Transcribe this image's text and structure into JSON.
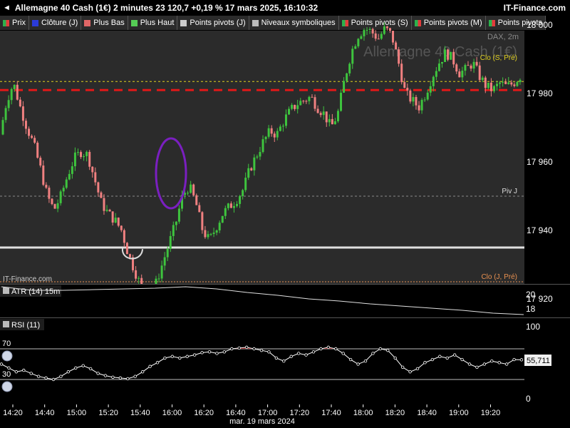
{
  "header": {
    "title": "Allemagne 40 Cash (1€) 2 minutes 23 120,7 +0,19 % 17 mars 2025, 16:10:32",
    "brand": "IT-Finance.com"
  },
  "legend": [
    {
      "label": "Prix",
      "color": "#2bb24c",
      "color2": "#e23b3b"
    },
    {
      "label": "Clôture (J)",
      "color": "#2b3bd8"
    },
    {
      "label": "Plus Bas",
      "color": "#e06666"
    },
    {
      "label": "Plus Haut",
      "color": "#55cc55"
    },
    {
      "label": "Points pivots (J)",
      "color": "#cccccc"
    },
    {
      "label": "Niveaux symboliques",
      "color": "#bbbbbb"
    },
    {
      "label": "Points pivots (S)",
      "color": "#2bb24c",
      "color2": "#e23b3b"
    },
    {
      "label": "Points pivots (M)",
      "color": "#2bb24c",
      "color2": "#e23b3b"
    },
    {
      "label": "Points pivots",
      "color": "#2bb24c",
      "color2": "#e23b3b"
    }
  ],
  "main_panel": {
    "watermark": "Allemagne 40 Cash (1€)",
    "instrument_label": "DAX, 2m",
    "source_label": "IT-Finance.com",
    "level_labels": {
      "clo_s": "Clo (S, Pré)",
      "piv_j": "Piv J",
      "clo_j": "Clo (J, Pré)"
    },
    "colors": {
      "up": "#3ec43e",
      "down": "#f08080",
      "red_line": "#e01818",
      "yellow_line": "#e0d020",
      "piv_line": "#e0e0e0",
      "orange_label": "#e89050",
      "ellipse": "#7a1fc0"
    }
  },
  "atr_panel": {
    "label": "ATR (14) 15m",
    "ticks": [
      "20",
      "18"
    ]
  },
  "rsi_panel": {
    "label": "RSI (11)",
    "ticks": [
      "100",
      "0"
    ],
    "overbought": "70",
    "oversold": "30",
    "current_value": "55,711"
  },
  "x_axis": {
    "date_label": "mar. 19 mars 2024"
  },
  "chart_data": {
    "type": "candlestick",
    "x": [
      "14:20",
      "14:40",
      "15:00",
      "15:20",
      "15:40",
      "16:00",
      "16:20",
      "16:40",
      "17:00",
      "17:20",
      "17:40",
      "18:00",
      "18:20",
      "18:40",
      "19:00",
      "19:20"
    ],
    "y_ticks": [
      18000,
      17980,
      17960,
      17940,
      17920
    ],
    "ylim": [
      17907,
      18003
    ],
    "levels": {
      "clo_s_pre": 17983,
      "red_dashed": 17981,
      "upper_gray_dashed": 17983.5,
      "mid_gray_dashed": 17950,
      "piv_j": 17935,
      "clo_j_pre": 17907
    },
    "price_path": [
      17968,
      17978,
      17983,
      17976,
      17970,
      17965,
      17958,
      17950,
      17946,
      17950,
      17956,
      17961,
      17963,
      17962,
      17955,
      17948,
      17945,
      17943,
      17940,
      17933,
      17928,
      17923,
      17920,
      17924,
      17930,
      17936,
      17942,
      17950,
      17953,
      17948,
      17940,
      17937,
      17941,
      17945,
      17947,
      17949,
      17952,
      17958,
      17962,
      17966,
      17969,
      17968,
      17972,
      17975,
      17977,
      17978,
      17979,
      17976,
      17974,
      17970,
      17974,
      17984,
      17992,
      17997,
      17999,
      17998,
      17996,
      17999,
      17997,
      17989,
      17980,
      17978,
      17976,
      17980,
      17985,
      17989,
      17992,
      17990,
      17986,
      17987,
      17989,
      17985,
      17982,
      17981,
      17983,
      17982,
      17983,
      17985
    ],
    "atr_path": [
      21.0,
      20.5,
      20.5,
      20.6,
      20.7,
      20.8,
      21.0,
      20.7,
      20.2,
      19.8,
      19.3,
      19.0,
      18.6,
      18.3,
      18.0,
      17.7,
      17.3,
      17.1
    ],
    "rsi_path": [
      50,
      45,
      40,
      42,
      38,
      34,
      32,
      30,
      34,
      40,
      45,
      48,
      44,
      38,
      35,
      33,
      32,
      31,
      34,
      40,
      47,
      52,
      58,
      60,
      58,
      60,
      62,
      65,
      66,
      64,
      66,
      70,
      71,
      72,
      70,
      68,
      66,
      58,
      54,
      60,
      64,
      62,
      66,
      70,
      72,
      70,
      64,
      56,
      50,
      54,
      64,
      70,
      68,
      58,
      46,
      40,
      44,
      52,
      56,
      60,
      58,
      62,
      56,
      50,
      46,
      50,
      54,
      52,
      50,
      56,
      55.7
    ],
    "rsi_current": 55.711
  }
}
